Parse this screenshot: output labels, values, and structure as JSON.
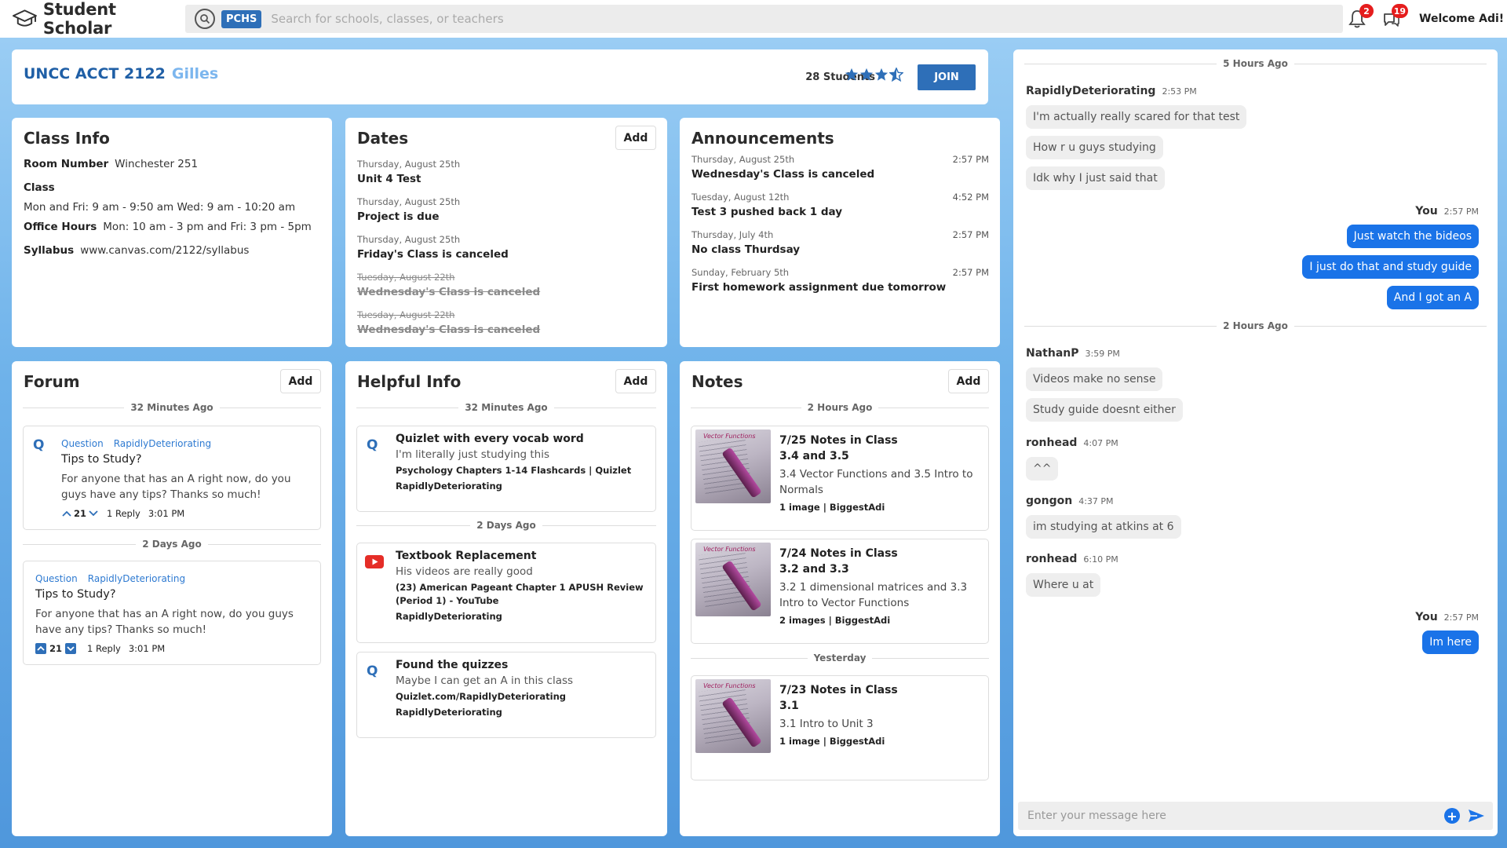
{
  "brand": {
    "name": "Student Scholar"
  },
  "search": {
    "chip": "PCHS",
    "placeholder": "Search for schools, classes, or teachers"
  },
  "notifications": {
    "count": "2"
  },
  "messages": {
    "count": "19"
  },
  "user": {
    "welcome": "Welcome Adi!"
  },
  "course": {
    "name": "UNCC ACCT 2122",
    "professor": "Gilles",
    "students": "28 Students",
    "rating": 4,
    "join_label": "JOIN"
  },
  "class_info": {
    "title": "Class Info",
    "room_label": "Room Number",
    "room_value": "Winchester 251",
    "class_label": "Class",
    "class_value": "Mon and Fri: 9 am - 9:50 am Wed: 9 am - 10:20 am",
    "office_label": "Office Hours",
    "office_value": "Mon: 10 am - 3 pm and Fri: 3 pm - 5pm",
    "syllabus_label": "Syllabus",
    "syllabus_value": "www.canvas.com/2122/syllabus"
  },
  "dates": {
    "title": "Dates",
    "add_label": "Add",
    "items": [
      {
        "date": "Thursday, August 25th",
        "title": "Unit 4 Test",
        "done": false
      },
      {
        "date": "Thursday, August 25th",
        "title": "Project is due",
        "done": false
      },
      {
        "date": "Thursday, August 25th",
        "title": "Friday's Class is canceled",
        "done": false
      },
      {
        "date": "Tuesday, August 22th",
        "title": "Wednesday's Class is canceled",
        "done": true
      },
      {
        "date": "Tuesday, August 22th",
        "title": "Wednesday's Class is canceled",
        "done": true
      }
    ]
  },
  "announcements": {
    "title": "Announcements",
    "items": [
      {
        "date": "Thursday, August 25th",
        "time": "2:57 PM",
        "title": "Wednesday's Class is canceled"
      },
      {
        "date": "Tuesday, August 12th",
        "time": "4:52 PM",
        "title": "Test 3 pushed back 1 day"
      },
      {
        "date": "Thursday, July 4th",
        "time": "2:57 PM",
        "title": "No class Thurdsay"
      },
      {
        "date": "Sunday, February 5th",
        "time": "2:57 PM",
        "title": "First homework assignment due tomorrow"
      }
    ]
  },
  "forum": {
    "title": "Forum",
    "add_label": "Add",
    "groups": [
      {
        "label": "32 Minutes Ago",
        "posts": [
          {
            "icon": "Q",
            "tag": "Question",
            "author": "RapidlyDeteriorating",
            "title": "Tips to Study?",
            "body": "For anyone that has an A right now, do you guys have any tips? Thanks so much!",
            "votes": "21",
            "replies": "1 Reply",
            "time": "3:01 PM"
          }
        ]
      },
      {
        "label": "2 Days Ago",
        "posts": [
          {
            "tag": "Question",
            "author": "RapidlyDeteriorating",
            "title": "Tips to Study?",
            "body": "For anyone that has an A right now, do you guys have any tips? Thanks so much!",
            "votes": "21",
            "replies": "1 Reply",
            "time": "3:01 PM"
          }
        ]
      }
    ]
  },
  "helpful": {
    "title": "Helpful Info",
    "add_label": "Add",
    "group1": "32 Minutes Ago",
    "group2": "2 Days Ago",
    "items": [
      {
        "icon": "Q",
        "title": "Quizlet with every vocab word",
        "sub": "I'm literally just studying this",
        "link": "Psychology Chapters 1-14 Flashcards | Quizlet",
        "user": "RapidlyDeteriorating"
      },
      {
        "icon": "youtube-icon",
        "title": "Textbook Replacement",
        "sub": "His videos are really good",
        "link": "(23) American Pageant Chapter 1 APUSH Review (Period 1) - YouTube",
        "user": "RapidlyDeteriorating"
      },
      {
        "icon": "Q",
        "title": "Found the quizzes",
        "sub": "Maybe I can get an A in this class",
        "link": "Quizlet.com/RapidlyDeteriorating",
        "user": "RapidlyDeteriorating"
      }
    ]
  },
  "notes": {
    "title": "Notes",
    "add_label": "Add",
    "group1": "2 Hours Ago",
    "group2": "Yesterday",
    "thumb_caption": "Vector Functions",
    "items": [
      {
        "title1": "7/25 Notes in Class",
        "title2": "3.4 and 3.5",
        "desc": "3.4 Vector Functions and 3.5 Intro to Normals",
        "meta": "1 image | BiggestAdi"
      },
      {
        "title1": "7/24 Notes in Class",
        "title2": "3.2 and 3.3",
        "desc": "3.2 1 dimensional matrices and 3.3 Intro to Vector Functions",
        "meta": "2 images | BiggestAdi"
      },
      {
        "title1": "7/23 Notes in Class",
        "title2": "3.1",
        "desc": "3.1 Intro to Unit 3",
        "meta": "1 image | BiggestAdi"
      }
    ]
  },
  "chat": {
    "div1": "5 Hours Ago",
    "div2": "2 Hours Ago",
    "u1": {
      "name": "RapidlyDeteriorating",
      "time": "2:53 PM",
      "msgs": [
        "I'm actually really scared for that test",
        "How r u guys studying",
        "Idk why I just said that"
      ]
    },
    "you1": {
      "name": "You",
      "time": "2:57 PM",
      "msgs": [
        "Just watch the bideos",
        "I just do that and study guide",
        "And I got an A"
      ]
    },
    "u2": {
      "name": "NathanP",
      "time": "3:59 PM",
      "msgs": [
        "Videos make no sense",
        "Study guide doesnt either"
      ]
    },
    "u3": {
      "name": "ronhead",
      "time": "4:07 PM",
      "msgs": [
        "^^"
      ]
    },
    "u4": {
      "name": "gongon",
      "time": "4:37 PM",
      "msgs": [
        "im studying at atkins at 6"
      ]
    },
    "u5": {
      "name": "ronhead",
      "time": "6:10 PM",
      "msgs": [
        "Where u at"
      ]
    },
    "you2": {
      "name": "You",
      "time": "2:57 PM",
      "msgs": [
        "Im here"
      ]
    },
    "input_placeholder": "Enter your message here"
  },
  "colors": {
    "accent": "#2e6fb8",
    "chat_bubble": "#1a73e8",
    "badge": "#e51d1d"
  }
}
